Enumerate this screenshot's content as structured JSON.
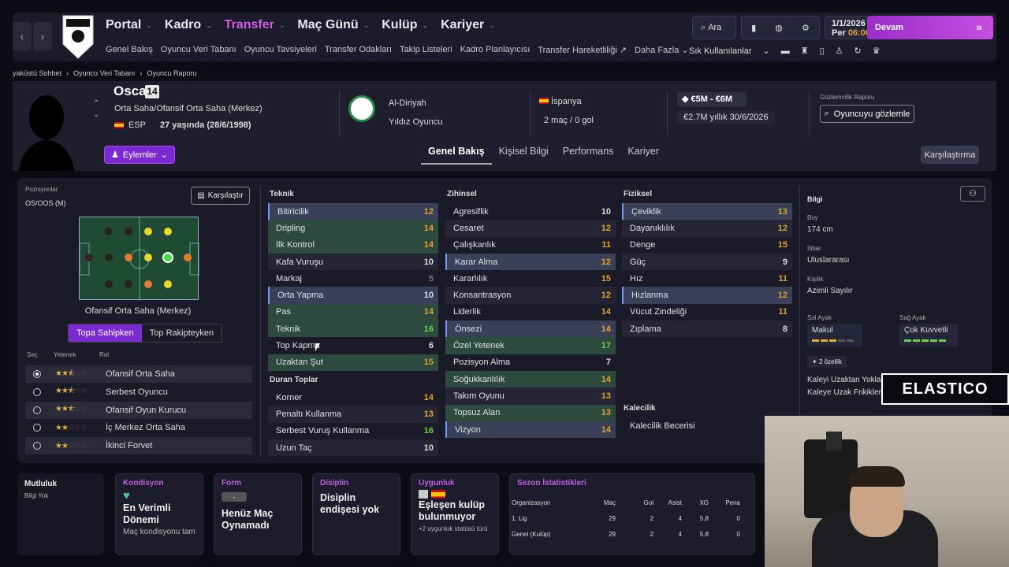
{
  "nav": {
    "items": [
      {
        "label": "Portal"
      },
      {
        "label": "Kadro"
      },
      {
        "label": "Transfer",
        "active": true
      },
      {
        "label": "Maç Günü"
      },
      {
        "label": "Kulüp"
      },
      {
        "label": "Kariyer"
      }
    ],
    "sub": [
      "Genel Bakış",
      "Oyuncu Veri Tabanı",
      "Oyuncu Tavsiyeleri",
      "Transfer Odakları",
      "Takip Listeleri",
      "Kadro Planlayıcısı",
      "Transfer Hareketliliği ↗",
      "Daha Fazla ⌄"
    ],
    "search": "Ara",
    "date": "1/1/2026",
    "day": "Per",
    "time": "06:00",
    "continue": "Devam",
    "quick": "Sık Kullanılanlar"
  },
  "breadcrumb": [
    "yaküstü Sohbet",
    "Oyuncu Veri Tabanı",
    "Oyuncu Raporu"
  ],
  "player": {
    "name": "Oscar",
    "number": "14",
    "position": "Orta Saha/Ofansif Orta Saha (Merkez)",
    "nation": "ESP",
    "age": "27 yaşında (28/6/1998)",
    "actions": "Eylemler",
    "club": "Al-Diriyah",
    "status": "Yıldız Oyuncu",
    "country": "İspanya",
    "caps": "2 maç / 0 gol",
    "value": "€5M - €6M",
    "contract": "€2.7M yıllık  30/6/2026",
    "scout_label": "Gözlemcilik Raporu",
    "scout_btn": "Oyuncuyu gözlemle"
  },
  "tabs": [
    "Genel Bakış",
    "Kişisel Bilgi",
    "Performans",
    "Kariyer"
  ],
  "compare": "Karşılaştırma",
  "positions": {
    "label": "Pozisyonlar",
    "value": "OS/OOS (M)",
    "compare": "Karşılaştır",
    "pitch_label": "Ofansif Orta Saha (Merkez)",
    "btn_on": "Topa Sahipken",
    "btn_off": "Top Rakipteyken",
    "hdr_sel": "Seç",
    "hdr_abil": "Yetenek",
    "hdr_role": "Rol",
    "roles": [
      {
        "name": "Ofansif Orta Saha",
        "stars": 2.5,
        "sel": true
      },
      {
        "name": "Serbest Oyuncu",
        "stars": 2.5
      },
      {
        "name": "Ofansif Oyun Kurucu",
        "stars": 2.5
      },
      {
        "name": "İç Merkez Orta Saha",
        "stars": 2
      },
      {
        "name": "İkinci Forvet",
        "stars": 2
      }
    ]
  },
  "attr": {
    "teknik": {
      "title": "Teknik",
      "rows": [
        [
          "Bitiricilik",
          12,
          "hb"
        ],
        [
          "Dripling",
          14,
          "hl"
        ],
        [
          "İlk Kontrol",
          14,
          "hl"
        ],
        [
          "Kafa Vuruşu",
          10,
          "alt"
        ],
        [
          "Markaj",
          5,
          ""
        ],
        [
          "Orta Yapma",
          10,
          "hb"
        ],
        [
          "Pas",
          14,
          "hl"
        ],
        [
          "Teknik",
          16,
          "hl"
        ],
        [
          "Top Kapma",
          6,
          ""
        ],
        [
          "Uzaktan Şut",
          15,
          "hl"
        ]
      ]
    },
    "duran": {
      "title": "Duran Toplar",
      "rows": [
        [
          "Korner",
          14,
          ""
        ],
        [
          "Penaltı Kullanma",
          13,
          "alt"
        ],
        [
          "Serbest Vuruş Kullanma",
          16,
          ""
        ],
        [
          "Uzun Taç",
          10,
          "alt"
        ]
      ]
    },
    "zihinsel": {
      "title": "Zihinsel",
      "rows": [
        [
          "Agresiflik",
          10,
          ""
        ],
        [
          "Cesaret",
          12,
          "alt"
        ],
        [
          "Çalışkanlık",
          11,
          ""
        ],
        [
          "Karar Alma",
          12,
          "hb"
        ],
        [
          "Kararlılık",
          15,
          ""
        ],
        [
          "Konsantrasyon",
          12,
          "alt"
        ],
        [
          "Liderlik",
          14,
          ""
        ],
        [
          "Önsezi",
          14,
          "hb"
        ],
        [
          "Özel Yetenek",
          17,
          "hl"
        ],
        [
          "Pozisyon Alma",
          7,
          ""
        ],
        [
          "Soğukkanlılık",
          14,
          "hl"
        ],
        [
          "Takım Oyunu",
          13,
          "alt"
        ],
        [
          "Topsuz Alan",
          13,
          "hl"
        ],
        [
          "Vizyon",
          14,
          "hb"
        ]
      ]
    },
    "fiziksel": {
      "title": "Fiziksel",
      "rows": [
        [
          "Çeviklik",
          13,
          "hb"
        ],
        [
          "Dayanıklılık",
          12,
          "alt"
        ],
        [
          "Denge",
          15,
          ""
        ],
        [
          "Güç",
          9,
          "alt"
        ],
        [
          "Hız",
          11,
          ""
        ],
        [
          "Hızlanma",
          12,
          "hb"
        ],
        [
          "Vücut Zindeliği",
          11,
          ""
        ],
        [
          "Zıplama",
          8,
          "alt"
        ]
      ]
    },
    "kalecilik": {
      "title": "Kalecilik",
      "rows": [
        [
          "Kalecilik Becerisi",
          "",
          ""
        ]
      ]
    }
  },
  "bilgi": {
    "title": "Bilgi",
    "boy_l": "Boy",
    "boy": "174 cm",
    "itibar_l": "İtibar",
    "itibar": "Uluslararası",
    "kisilik_l": "Kişilik",
    "kisilik": "Azimli Sayılır",
    "sol_l": "Sol Ayak",
    "sol": "Makul",
    "sag_l": "Sağ Ayak",
    "sag": "Çok Kuvvetli",
    "traits": "2 özellik",
    "t1": "Kaleyi Uzaktan Yokla",
    "t2": "Kaleye Uzak Frikikler"
  },
  "bottom": {
    "mutluluk": "Mutluluk",
    "mutluluk_v": "Bilgi Yok",
    "kond": "Kondisyon",
    "kond_v": "En Verimli Dönemi",
    "kond_s": "Maç kondisyonu tam",
    "form": "Form",
    "form_b": "-",
    "form_v": "Henüz Maç Oynamadı",
    "disiplin": "Disiplin",
    "disiplin_v": "Disiplin endişesi yok",
    "uygun": "Uygunluk",
    "uygun_v": "Eşleşen kulüp bulunmuyor",
    "uygun_s": "+2 uygunluk statüsü türü",
    "sezon": "Sezon İstatistikleri",
    "cols": [
      "Organizasyon",
      "Maç",
      "Gol",
      "Asist",
      "XG",
      "Pena"
    ],
    "rows": [
      [
        "1. Lig",
        "29",
        "2",
        "4",
        "5.8",
        "0"
      ],
      [
        "Genel (Kulüp)",
        "29",
        "2",
        "4",
        "5.8",
        "0"
      ]
    ]
  },
  "overlay": "ELASTICO"
}
